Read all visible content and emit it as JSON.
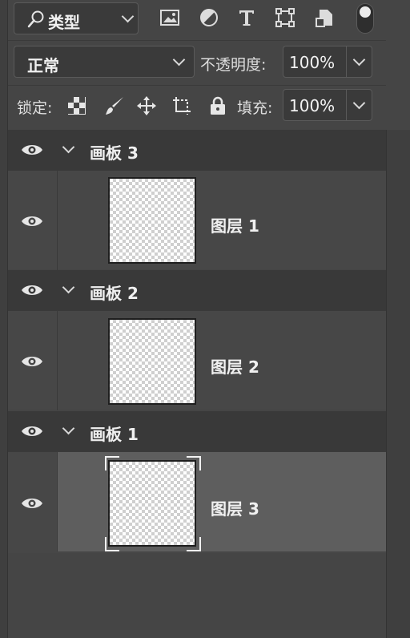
{
  "filter": {
    "selected": "类型",
    "icons": [
      "magnifier-icon",
      "image-filter-icon",
      "adjustment-filter-icon",
      "type-filter-icon",
      "shape-filter-icon",
      "smart-object-filter-icon"
    ]
  },
  "blend": {
    "mode": "正常",
    "opacity_label": "不透明度:",
    "opacity_value": "100%"
  },
  "lock": {
    "label": "锁定:",
    "fill_label": "填充:",
    "fill_value": "100%",
    "icons": [
      "lock-transparent-icon",
      "lock-image-icon",
      "lock-position-icon",
      "lock-artboard-icon",
      "lock-all-icon"
    ]
  },
  "groups": [
    {
      "title": "画板 3",
      "layer": "图层 1",
      "selected": false
    },
    {
      "title": "画板 2",
      "layer": "图层 2",
      "selected": false
    },
    {
      "title": "画板 1",
      "layer": "图层 3",
      "selected": true
    }
  ],
  "colors": {
    "panel": "#454545",
    "header": "#393939",
    "row": "#474747",
    "selected_row": "#5e5e5e"
  }
}
